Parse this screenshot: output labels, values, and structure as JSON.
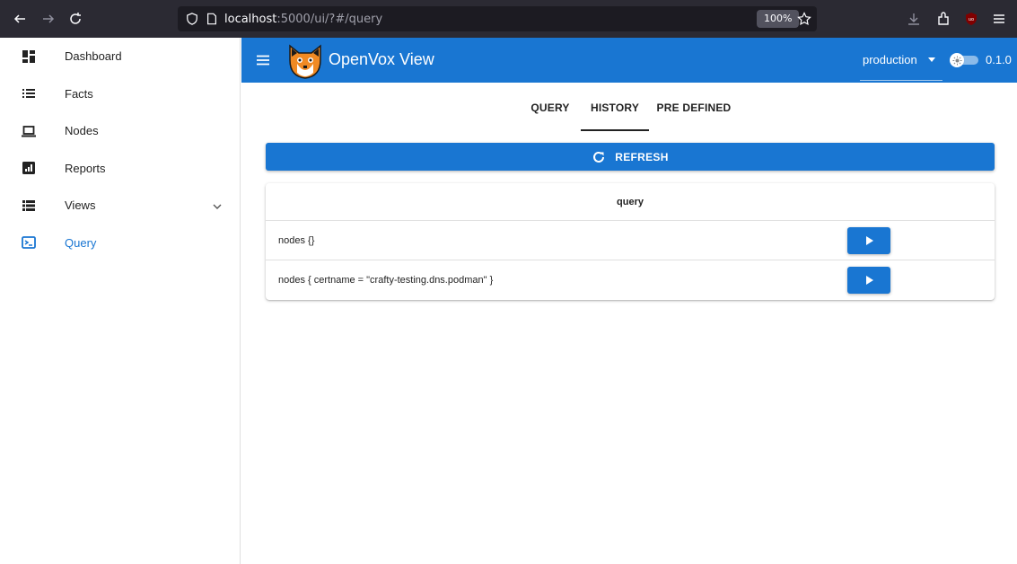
{
  "browser": {
    "url_host": "localhost",
    "url_path": ":5000/ui/?#/query",
    "zoom": "100%"
  },
  "sidebar": {
    "items": [
      {
        "label": "Dashboard",
        "icon": "dashboard-icon"
      },
      {
        "label": "Facts",
        "icon": "list-icon"
      },
      {
        "label": "Nodes",
        "icon": "laptop-icon"
      },
      {
        "label": "Reports",
        "icon": "chart-icon"
      },
      {
        "label": "Views",
        "icon": "view-list-icon"
      },
      {
        "label": "Query",
        "icon": "terminal-icon"
      }
    ],
    "active": "Query"
  },
  "appbar": {
    "title": "OpenVox View",
    "environment": "production",
    "version": "0.1.0",
    "color": "#1976d2"
  },
  "tabs": [
    "QUERY",
    "HISTORY",
    "PRE DEFINED"
  ],
  "active_tab": "HISTORY",
  "refresh_label": "REFRESH",
  "table": {
    "header": "query",
    "rows": [
      "nodes {}",
      "nodes { certname = \"crafty-testing.dns.podman\" }"
    ]
  }
}
